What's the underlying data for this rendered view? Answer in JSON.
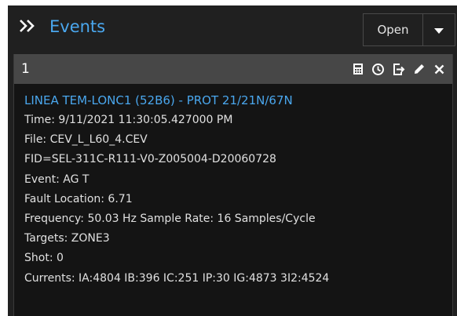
{
  "header": {
    "collapse_icon": "double-chevron-right-icon",
    "title": "Events",
    "open_label": "Open",
    "dropdown_icon": "caret-down-icon"
  },
  "colors": {
    "accent": "#4aa7ee",
    "panel_bg": "#202020",
    "card_bg": "#141414",
    "card_header_bg": "#474747",
    "text": "#e0e0e0"
  },
  "event_card": {
    "number": "1",
    "actions": [
      "calculator-icon",
      "clock-icon",
      "export-icon",
      "edit-pencil-icon",
      "close-icon"
    ],
    "title": "LINEA TEM-LONC1 (52B6) - PROT 21/21N/67N",
    "time": "Time:  9/11/2021 11:30:05.427000 PM",
    "file": "File: CEV_L_L60_4.CEV",
    "fid": "FID=SEL-311C-R111-V0-Z005004-D20060728",
    "event": "Event: AG T",
    "fault_location": "Fault Location: 6.71",
    "frequency": "Frequency: 50.03 Hz   Sample Rate: 16 Samples/Cycle",
    "targets": "Targets: ZONE3",
    "shot": "Shot: 0",
    "currents": "Currents: IA:4804 IB:396 IC:251 IP:30 IG:4873 3I2:4524"
  }
}
